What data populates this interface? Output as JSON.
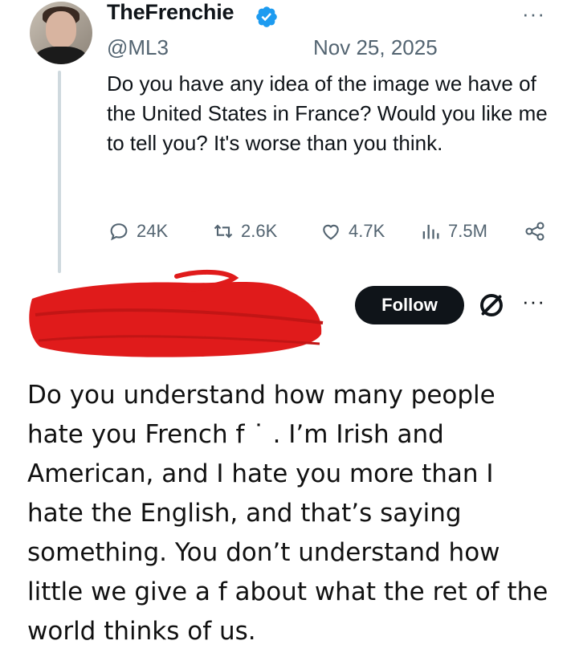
{
  "tweet": {
    "display_name": "TheFrenchie",
    "handle": "@ML3",
    "date": "Nov 25, 2025",
    "text": "Do you have any idea of the image we have of the United States in France? Would you like me to tell you? It's worse than you think.",
    "stats": {
      "replies": "24K",
      "retweets": "2.6K",
      "likes": "4.7K",
      "views": "7.5M"
    },
    "more_label": "···"
  },
  "reply": {
    "follow_label": "Follow",
    "more_label": "···",
    "text": "Do you understand how many people hate you French f  ˙ . I’m Irish and American,  and I hate you more than I hate the English, and that’s saying something. You don’t understand how little we give a f      about what the ret of the world thinks of us."
  },
  "colors": {
    "verified": "#1d9bf0",
    "redaction": "#e01b1b",
    "muted": "#536471"
  },
  "icons": [
    "verified-badge-icon",
    "reply-icon",
    "retweet-icon",
    "like-icon",
    "views-icon",
    "share-icon",
    "no-entry-icon",
    "more-icon"
  ]
}
